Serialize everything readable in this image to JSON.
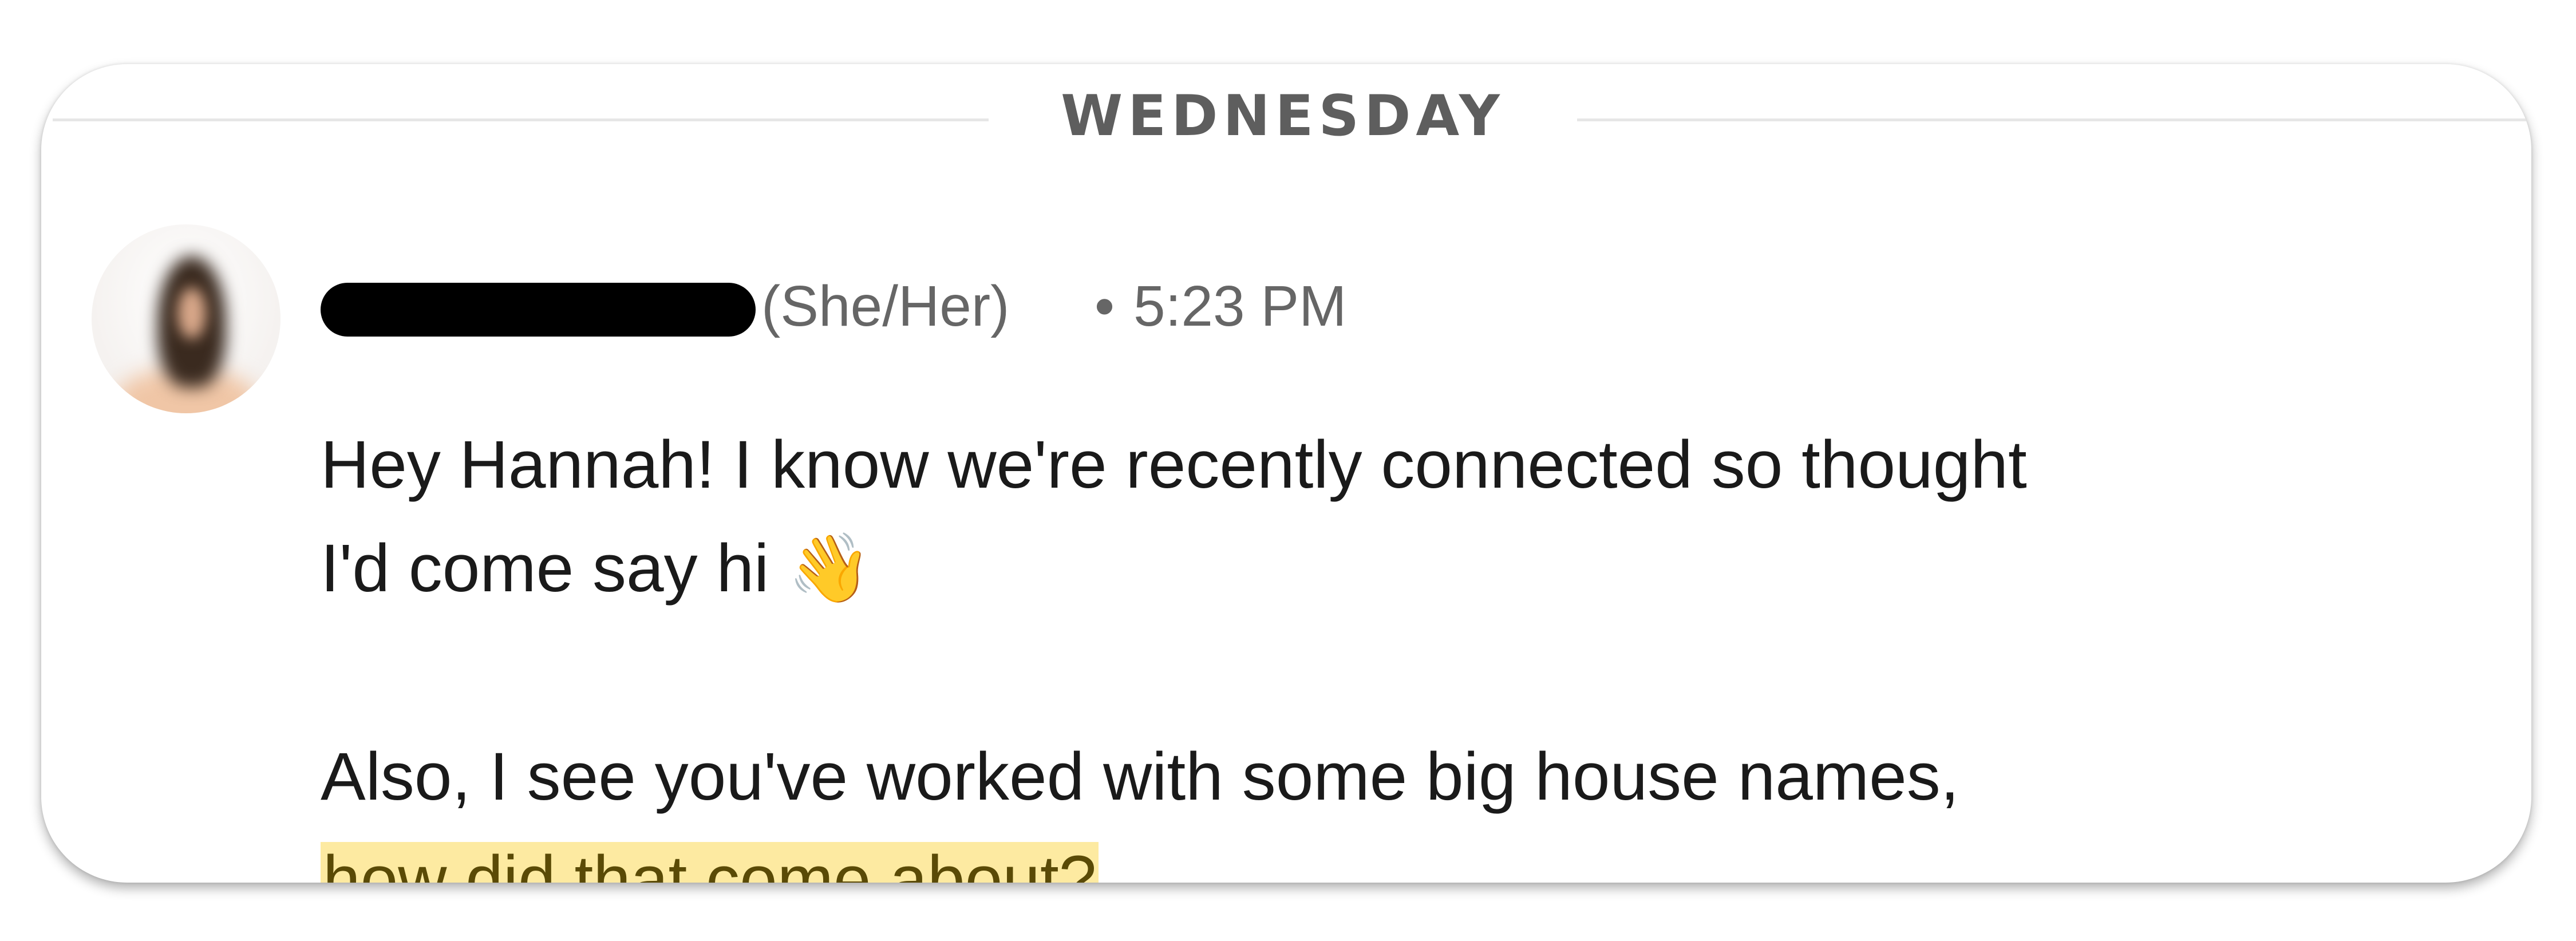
{
  "conversation": {
    "date_divider": "WEDNESDAY",
    "message": {
      "sender_pronouns": "(She/Her)",
      "separator": "•",
      "timestamp": "5:23 PM",
      "line1": "Hey Hannah! I know we're recently connected so thought",
      "line2_text": "I'd come say hi ",
      "line2_emoji": "👋",
      "line3": "Also, I see you've worked with some big house names,",
      "line4_highlighted": "how did that come about",
      "line4_end": "?"
    }
  },
  "colors": {
    "highlight": "#fdeaa1",
    "meta_text": "#666666",
    "body_text": "#1a1a1a",
    "redaction": "#000000"
  },
  "icons": {
    "avatar": "profile-photo",
    "emoji": "waving-hand"
  }
}
